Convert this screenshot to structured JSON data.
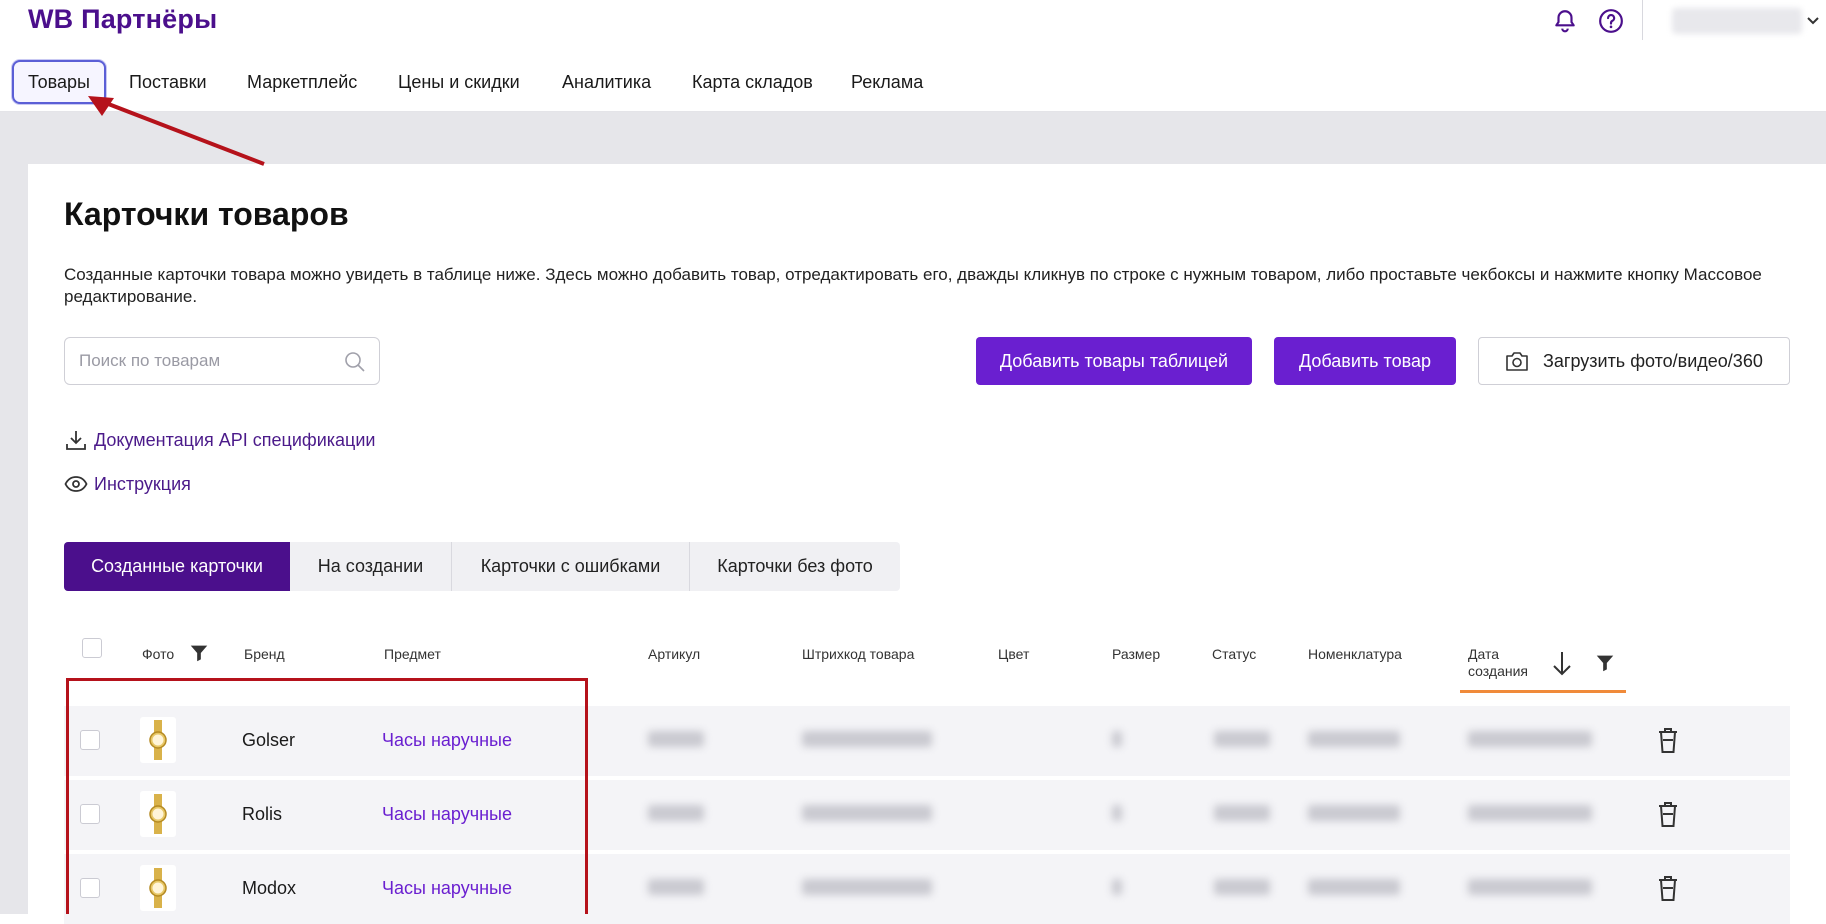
{
  "app": {
    "logo": "WB Партнёры"
  },
  "nav": {
    "items": [
      {
        "label": "Товары",
        "active": true
      },
      {
        "label": "Поставки"
      },
      {
        "label": "Маркетплейс"
      },
      {
        "label": "Цены и скидки"
      },
      {
        "label": "Аналитика"
      },
      {
        "label": "Карта складов"
      },
      {
        "label": "Реклама"
      }
    ]
  },
  "page": {
    "title": "Карточки товаров",
    "description": "Созданные карточки товара можно увидеть в таблице ниже. Здесь можно добавить товар, отредактировать его, дважды кликнув по строке с нужным товаром, либо проставьте чекбоксы и нажмите кнопку Массовое редактирование."
  },
  "search": {
    "placeholder": "Поиск по товарам",
    "value": ""
  },
  "actions": {
    "add_table": "Добавить товары таблицей",
    "add_item": "Добавить товар",
    "upload_media": "Загрузить фото/видео/360"
  },
  "links": {
    "api_docs": "Документация API спецификации",
    "instruction": "Инструкция"
  },
  "tabs": [
    {
      "label": "Созданные карточки",
      "active": true
    },
    {
      "label": "На создании"
    },
    {
      "label": "Карточки с ошибками"
    },
    {
      "label": "Карточки без фото"
    }
  ],
  "table": {
    "headers": {
      "photo": "Фото",
      "brand": "Бренд",
      "subject": "Предмет",
      "article": "Артикул",
      "barcode": "Штрихкод товара",
      "color": "Цвет",
      "size": "Размер",
      "status": "Статус",
      "nomenclature": "Номенклатура",
      "created": "Дата создания"
    },
    "rows": [
      {
        "brand": "Golser",
        "subject": "Часы наручные"
      },
      {
        "brand": "Rolis",
        "subject": "Часы наручные"
      },
      {
        "brand": "Modox",
        "subject": "Часы наручные"
      }
    ]
  },
  "colors": {
    "brand": "#4b0f8c",
    "primary_button": "#6a1fd0",
    "highlight": "#b5121b",
    "sort_indicator": "#f08a3a"
  }
}
